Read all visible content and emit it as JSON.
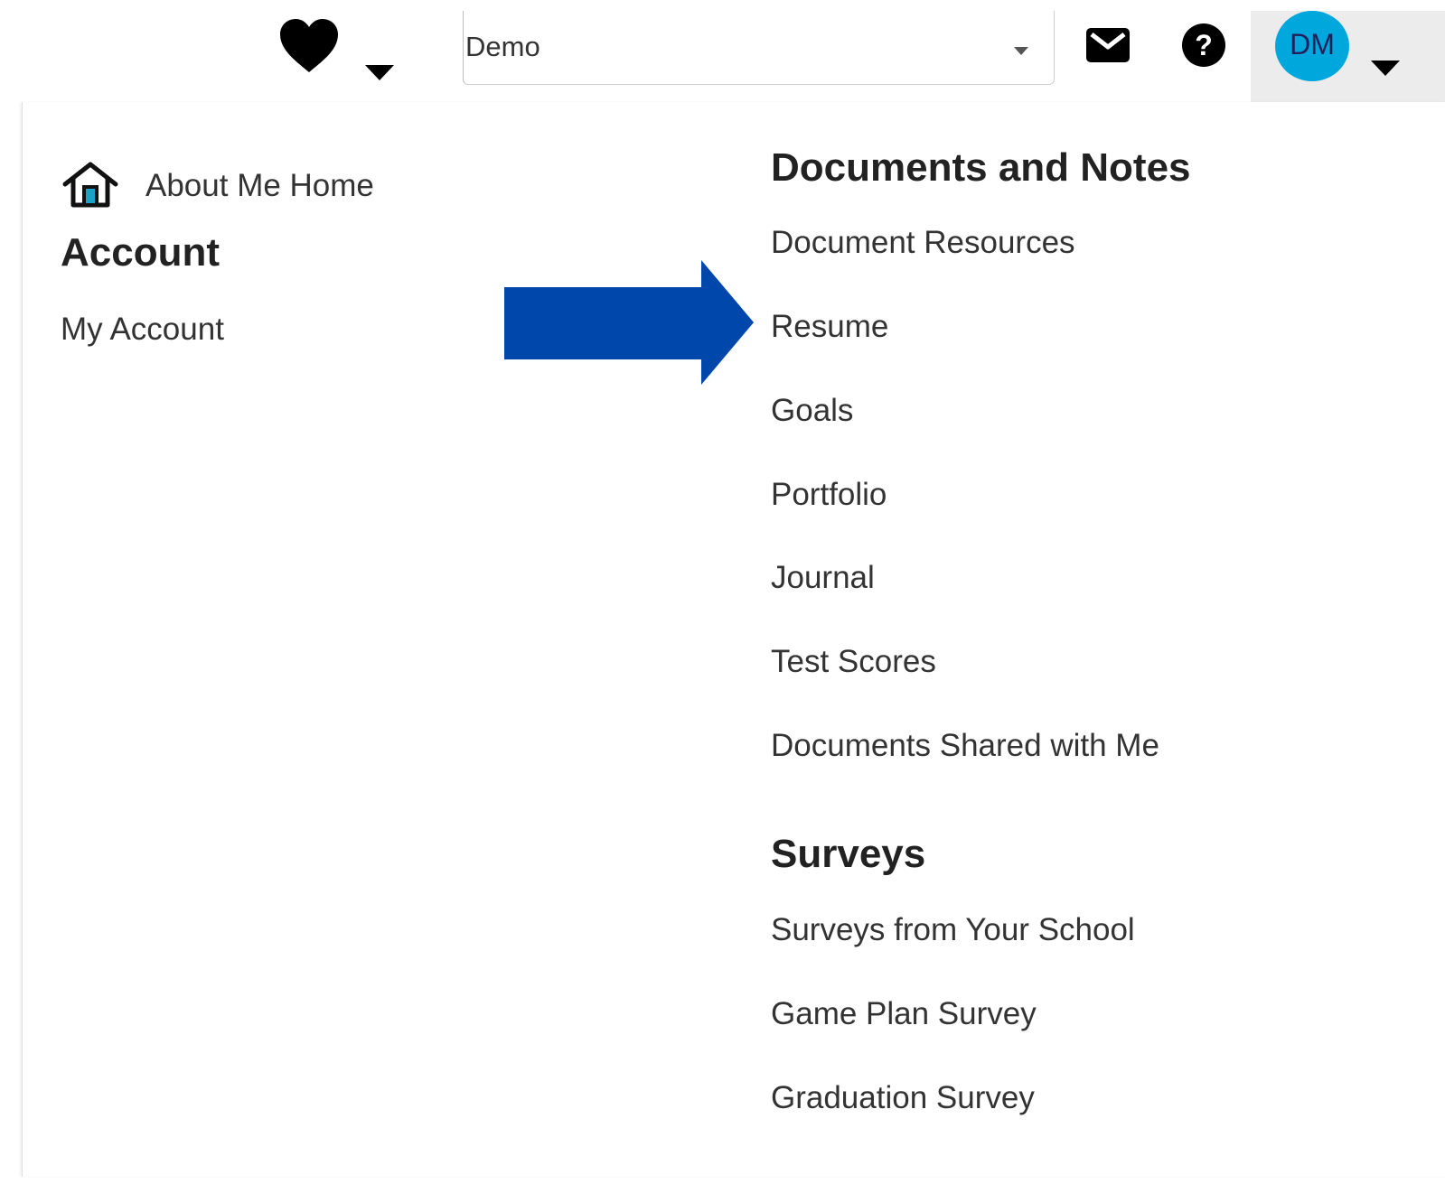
{
  "topbar": {
    "school_select": {
      "value": "Demo"
    },
    "user": {
      "initials": "DM"
    }
  },
  "menu": {
    "home": {
      "label": "About Me Home"
    },
    "account": {
      "heading": "Account",
      "items": [
        {
          "label": "My Account"
        }
      ]
    },
    "documents": {
      "heading": "Documents and Notes",
      "items": [
        {
          "label": "Document Resources"
        },
        {
          "label": "Resume"
        },
        {
          "label": "Goals"
        },
        {
          "label": "Portfolio"
        },
        {
          "label": "Journal"
        },
        {
          "label": "Test Scores"
        },
        {
          "label": "Documents Shared with Me"
        }
      ]
    },
    "surveys": {
      "heading": "Surveys",
      "items": [
        {
          "label": "Surveys from Your School"
        },
        {
          "label": "Game Plan Survey"
        },
        {
          "label": "Graduation Survey"
        }
      ]
    }
  },
  "colors": {
    "avatar_bg": "#00a7dd",
    "callout_arrow": "#0047ab",
    "text": "#333333"
  },
  "icons": {
    "favorites": "heart-icon",
    "mail": "mail-icon",
    "help": "help-icon",
    "home": "home-icon",
    "callout": "callout-arrow"
  }
}
